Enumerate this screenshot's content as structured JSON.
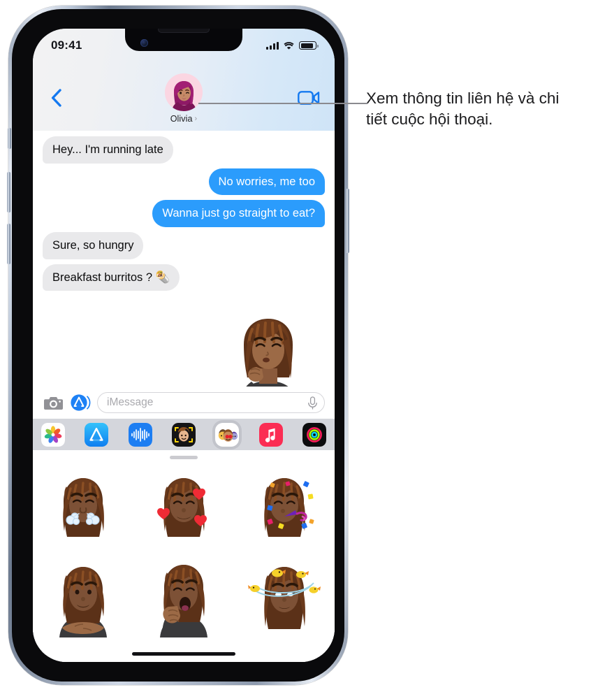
{
  "annotation": {
    "text": "Xem thông tin liên hệ và chi tiết cuộc hội thoại.",
    "target": "contact-name-button",
    "line_color": "#8a8a8f"
  },
  "device": {
    "name": "iPhone",
    "frame_color": "#b9c5d6"
  },
  "status_bar": {
    "time": "09:41",
    "cellular_icon": "signal-bars-icon",
    "cellular_bars": 4,
    "wifi_icon": "wifi-icon",
    "battery_icon": "battery-icon",
    "battery_level": 88
  },
  "nav_bar": {
    "back_icon": "chevron-left-icon",
    "back_label": "",
    "facetime_icon": "video-camera-icon",
    "contact": {
      "name": "Olivia",
      "chevron": "›",
      "avatar_icon": "memoji-avatar-olivia",
      "avatar_bg": "#fbd6e2",
      "hair_color": "#a21f74"
    },
    "accent_color": "#1c7cf2"
  },
  "conversation": {
    "bubble_in_color": "#e9e9eb",
    "bubble_out_color": "#2b9cfc",
    "messages": [
      {
        "id": 1,
        "side": "in",
        "text": "Hey... I'm running late"
      },
      {
        "id": 2,
        "side": "out",
        "text": "No worries, me too"
      },
      {
        "id": 3,
        "side": "out",
        "text": "Wanna just go straight to eat?"
      },
      {
        "id": 4,
        "side": "in",
        "text": "Sure, so hungry"
      },
      {
        "id": 5,
        "side": "in",
        "text": "Breakfast burritos ? 🌯"
      }
    ],
    "sent_sticker": {
      "icon": "memoji-sticker-kiss-fingers",
      "label": "Memoji chef kiss sticker"
    }
  },
  "input_bar": {
    "camera_icon": "camera-icon",
    "apps_icon": "app-store-icon",
    "placeholder": "iMessage",
    "value": "",
    "dictation_icon": "microphone-icon"
  },
  "app_drawer": {
    "selected_index": 4,
    "apps": [
      {
        "name": "Photos",
        "icon": "photos-icon"
      },
      {
        "name": "App Store",
        "icon": "app-store-icon"
      },
      {
        "name": "Audio Messages",
        "icon": "audio-waveform-icon"
      },
      {
        "name": "Memoji",
        "icon": "memoji-icon"
      },
      {
        "name": "Memoji Stickers",
        "icon": "memoji-stickers-icon"
      },
      {
        "name": "Music",
        "icon": "music-icon"
      },
      {
        "name": "Fitness",
        "icon": "fitness-rings-icon"
      }
    ]
  },
  "sticker_sheet": {
    "grabber": "drawer-grabber",
    "stickers": [
      {
        "id": 1,
        "name": "memoji-sticker-steam-nose",
        "label": "Steam from nose"
      },
      {
        "id": 2,
        "name": "memoji-sticker-hearts",
        "label": "Smiling with hearts"
      },
      {
        "id": 3,
        "name": "memoji-sticker-party",
        "label": "Party horn and confetti"
      },
      {
        "id": 4,
        "name": "memoji-sticker-smile",
        "label": "Smiling"
      },
      {
        "id": 5,
        "name": "memoji-sticker-yawn",
        "label": "Yawning"
      },
      {
        "id": 6,
        "name": "memoji-sticker-birds",
        "label": "Birds circling head"
      }
    ],
    "home_indicator": "home-indicator"
  }
}
